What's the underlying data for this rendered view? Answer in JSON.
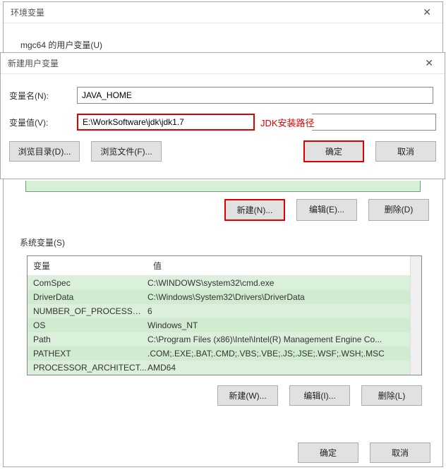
{
  "env_dialog": {
    "title": "环境变量",
    "user_vars_label": "mgc64 的用户变量(U)"
  },
  "new_dialog": {
    "title": "新建用户变量",
    "name_label": "变量名(N):",
    "name_value": "JAVA_HOME",
    "value_label": "变量值(V):",
    "value_value": "E:\\WorkSoftware\\jdk\\jdk1.7",
    "annotation": "JDK安装路径",
    "browse_dir": "浏览目录(D)...",
    "browse_file": "浏览文件(F)...",
    "ok": "确定",
    "cancel": "取消"
  },
  "under": {
    "new_n": "新建(N)...",
    "edit_e": "编辑(E)...",
    "del_d": "删除(D)"
  },
  "sysvars": {
    "label": "系统变量(S)",
    "col_var": "变量",
    "col_val": "值",
    "rows": [
      {
        "var": "ComSpec",
        "val": "C:\\WINDOWS\\system32\\cmd.exe"
      },
      {
        "var": "DriverData",
        "val": "C:\\Windows\\System32\\Drivers\\DriverData"
      },
      {
        "var": "NUMBER_OF_PROCESSORS",
        "val": "6"
      },
      {
        "var": "OS",
        "val": "Windows_NT"
      },
      {
        "var": "Path",
        "val": "C:\\Program Files (x86)\\Intel\\Intel(R) Management Engine Co..."
      },
      {
        "var": "PATHEXT",
        "val": ".COM;.EXE;.BAT;.CMD;.VBS;.VBE;.JS;.JSE;.WSF;.WSH;.MSC"
      },
      {
        "var": "PROCESSOR_ARCHITECT...",
        "val": "AMD64"
      }
    ],
    "new_w": "新建(W)...",
    "edit_i": "编辑(I)...",
    "del_l": "删除(L)"
  },
  "outer": {
    "ok": "确定",
    "cancel": "取消"
  }
}
